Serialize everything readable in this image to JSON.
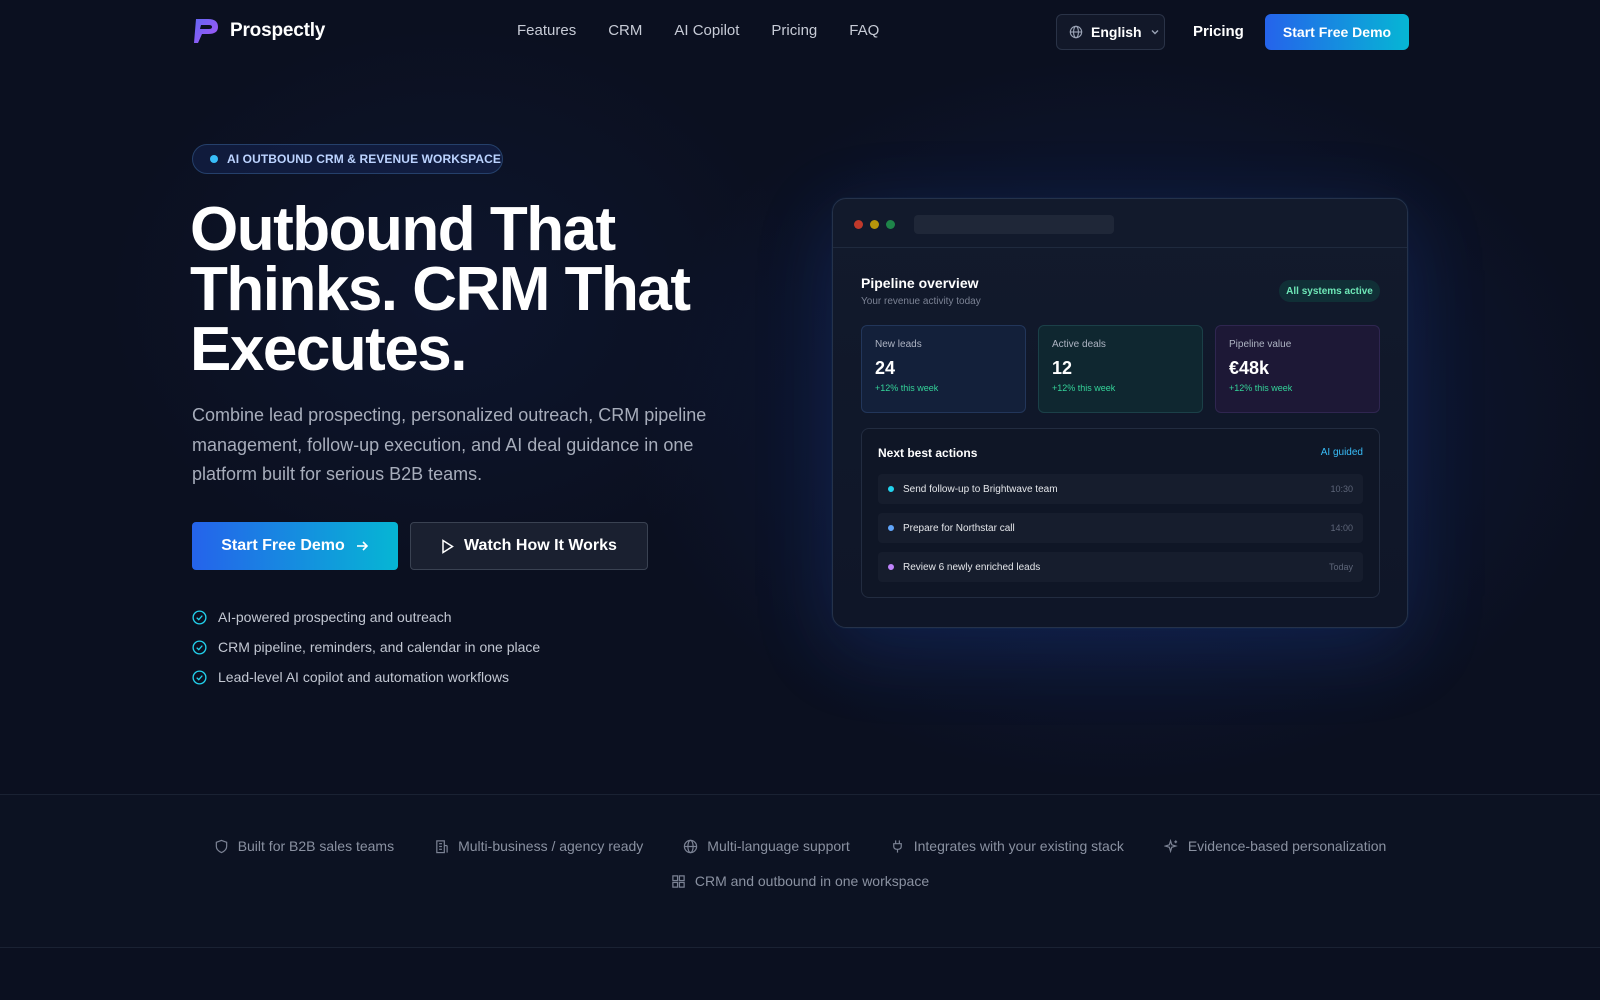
{
  "nav": {
    "brand": "Prospectly",
    "links": [
      "Features",
      "CRM",
      "AI Copilot",
      "Pricing",
      "FAQ"
    ],
    "language": "English",
    "pricing": "Pricing",
    "cta": "Start Free Demo"
  },
  "hero": {
    "eyebrow": "AI OUTBOUND CRM & REVENUE WORKSPACE",
    "headline": "Outbound That Thinks. CRM That Executes.",
    "subtitle": "Combine lead prospecting, personalized outreach, CRM pipeline management, follow-up execution, and AI deal guidance in one platform built for serious B2B teams.",
    "primary_cta": "Start Free Demo",
    "secondary_cta": "Watch How It Works",
    "checks": [
      "AI-powered prospecting and outreach",
      "CRM pipeline, reminders, and calendar in one place",
      "Lead-level AI copilot and automation workflows"
    ]
  },
  "dashboard": {
    "title": "Pipeline overview",
    "subtitle": "Your revenue activity today",
    "status": "All systems active",
    "stats": [
      {
        "label": "New leads",
        "value": "24",
        "delta": "+12% this week"
      },
      {
        "label": "Active deals",
        "value": "12",
        "delta": "+12% this week"
      },
      {
        "label": "Pipeline value",
        "value": "€48k",
        "delta": "+12% this week"
      }
    ],
    "actions_title": "Next best actions",
    "actions_tag": "AI guided",
    "actions": [
      {
        "text": "Send follow-up to Brightwave team",
        "time": "10:30",
        "color": "#22d3ee"
      },
      {
        "text": "Prepare for Northstar call",
        "time": "14:00",
        "color": "#60a5fa"
      },
      {
        "text": "Review 6 newly enriched leads",
        "time": "Today",
        "color": "#c084fc"
      }
    ]
  },
  "trust": {
    "items": [
      {
        "label": "Built for B2B sales teams",
        "icon": "shield-icon"
      },
      {
        "label": "Multi-business / agency ready",
        "icon": "building-icon"
      },
      {
        "label": "Multi-language support",
        "icon": "globe-icon"
      },
      {
        "label": "Integrates with your existing stack",
        "icon": "plug-icon"
      },
      {
        "label": "Evidence-based personalization",
        "icon": "sparkles-icon"
      },
      {
        "label": "CRM and outbound in one workspace",
        "icon": "grid-icon"
      }
    ]
  },
  "colors": {
    "background": "#0b1020",
    "accent_start": "#2563eb",
    "accent_end": "#06b6d4",
    "success": "#34d399"
  }
}
